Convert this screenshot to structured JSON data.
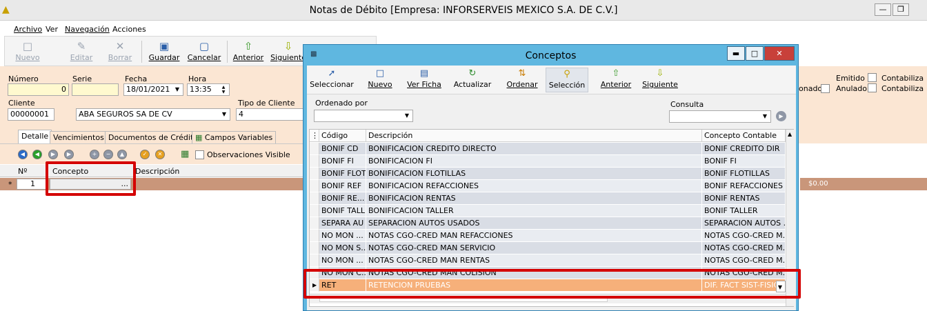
{
  "window": {
    "title": "Notas de Débito [Empresa: INFORSERVEIS MEXICO S.A. DE C.V.]",
    "minimize": "—",
    "restore": "❐"
  },
  "menu": [
    "Archivo",
    "Ver",
    "Navegación",
    "Acciones"
  ],
  "toolbar": {
    "nuevo": "Nuevo",
    "editar": "Editar",
    "borrar": "Borrar",
    "guardar": "Guardar",
    "cancelar": "Cancelar",
    "anterior": "Anterior",
    "siguiente": "Siguiente"
  },
  "form": {
    "numero_label": "Número",
    "numero_value": "0",
    "serie_label": "Serie",
    "serie_value": "",
    "fecha_label": "Fecha",
    "fecha_value": "18/01/2021",
    "hora_label": "Hora",
    "hora_value": "13:35",
    "cliente_label": "Cliente",
    "cliente_code": "00000001",
    "cliente_name": "ABA SEGUROS  SA DE CV",
    "tipo_cliente_label": "Tipo de Cliente",
    "tipo_cliente_value": "4",
    "emitido_label": "Emitido",
    "anulado_label": "Anulado",
    "contabilizado1_label": "Contabiliza",
    "contabilizado2_label": "Contabiliza",
    "partial_label": "onado"
  },
  "tabs": [
    "Detalle",
    "Vencimientos",
    "Documentos de Crédito",
    "Campos Variables"
  ],
  "subtoolbar": {
    "observaciones_label": "Observaciones Visible"
  },
  "detail_grid": {
    "headers": [
      "Nº",
      "Concepto",
      "Descripción"
    ],
    "row_marker": "*",
    "row_number": "1",
    "ellipsis": "...",
    "total": "$0.00"
  },
  "dialog": {
    "title": "Conceptos",
    "toolbar": [
      "Seleccionar",
      "Nuevo",
      "Ver Ficha",
      "Actualizar",
      "Ordenar",
      "Selección",
      "Anterior",
      "Siguiente"
    ],
    "ordenado_label": "Ordenado por",
    "consulta_label": "Consulta",
    "headers": [
      "Código",
      "Descripción",
      "Concepto Contable"
    ],
    "rows": [
      {
        "codigo": "BONIF CD",
        "descripcion": "BONIFICACION CREDITO DIRECTO",
        "contable": "BONIF CREDITO DIR"
      },
      {
        "codigo": "BONIF FI",
        "descripcion": "BONIFICACION FI",
        "contable": "BONIF FI"
      },
      {
        "codigo": "BONIF FLOT",
        "descripcion": "BONIFICACION FLOTILLAS",
        "contable": "BONIF FLOTILLAS"
      },
      {
        "codigo": "BONIF REF",
        "descripcion": "BONIFICACION REFACCIONES",
        "contable": "BONIF REFACCIONES"
      },
      {
        "codigo": "BONIF RE...",
        "descripcion": "BONIFICACION RENTAS",
        "contable": "BONIF RENTAS"
      },
      {
        "codigo": "BONIF TALL",
        "descripcion": "BONIFICACION TALLER",
        "contable": "BONIF TALLER"
      },
      {
        "codigo": "SEPARA AU",
        "descripcion": "SEPARACION AUTOS USADOS",
        "contable": "SEPARACION AUTOS ..."
      },
      {
        "codigo": "NO MON ...",
        "descripcion": "NOTAS CGO-CRED MAN REFACCIONES",
        "contable": "NOTAS CGO-CRED M..."
      },
      {
        "codigo": "NO MON S...",
        "descripcion": "NOTAS CGO-CRED MAN SERVICIO",
        "contable": "NOTAS CGO-CRED M..."
      },
      {
        "codigo": "NO MON ...",
        "descripcion": "NOTAS CGO-CRED MAN RENTAS",
        "contable": "NOTAS CGO-CRED M..."
      },
      {
        "codigo": "NO MON C...",
        "descripcion": "NOTAS CGO-CRED MAN COLISION",
        "contable": "NOTAS CGO-CRED M..."
      },
      {
        "codigo": "RET",
        "descripcion": "RETENCION PRUEBAS",
        "contable": "DIF. FACT SIST-FISIC..."
      }
    ],
    "selected_row_index": 11
  },
  "colors": {
    "form_bg": "#fbe6d3",
    "dialog_frame": "#5fb7e0",
    "selected_row": "#f6b07a",
    "highlight_box": "#d40000"
  }
}
